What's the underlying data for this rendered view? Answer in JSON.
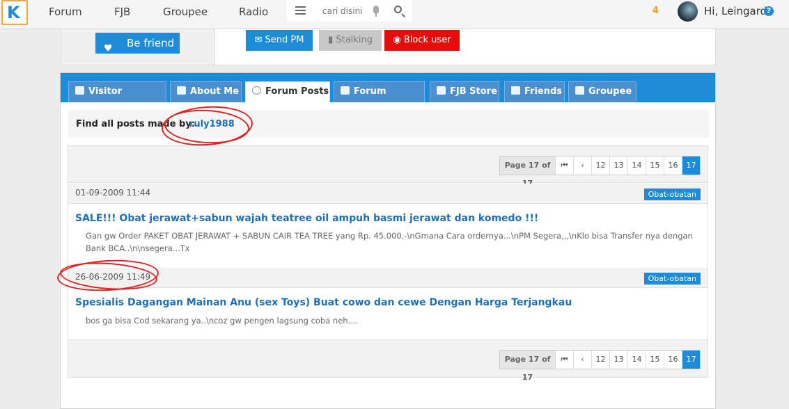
{
  "nav": {
    "logo": "K",
    "items": [
      "Forum",
      "FJB",
      "Groupee",
      "Radio"
    ],
    "search_placeholder": "cari disini",
    "notif_count": "4",
    "greeting": "Hi, Leingard",
    "help": "?"
  },
  "profile_actions": {
    "be_friend": "Be friend",
    "send_pm": "Send PM",
    "stalking": "Stalking",
    "block_user": "Block user"
  },
  "tabs": [
    "Visitor Message",
    "About Me",
    "Forum Posts",
    "Forum Thread",
    "FJB Store",
    "Friends",
    "Groupee"
  ],
  "active_tab": "Forum Posts",
  "find": {
    "label": "Find all posts made by:",
    "username": "ruly1988"
  },
  "pager": {
    "info": "Page 17 of 17",
    "first": "⏮",
    "prev": "‹",
    "pages": [
      "12",
      "13",
      "14",
      "15",
      "16"
    ],
    "current": "17"
  },
  "posts": [
    {
      "date": "01-09-2009 11:44",
      "category": "Obat-obatan",
      "title": "SALE!!! Obat jerawat+sabun wajah teatree oil ampuh basmi jerawat dan komedo !!!",
      "snippet": "Gan gw Order PAKET OBAT JERAWAT + SABUN CAIR TEA TREE yang Rp. 45.000,-\\nGmana Cara ordernya...\\nPM Segera,,,\\nKlo bisa Transfer nya dengan Bank BCA..\\n\\nsegera...Tx"
    },
    {
      "date": "26-06-2009 11:49",
      "category": "Obat-obatan",
      "title": "Spesialis Dagangan Mainan Anu (sex Toys) Buat cowo dan cewe Dengan Harga Terjangkau",
      "snippet": "bos ga bisa Cod sekarang ya..\\ncoz gw pengen lagsung coba neh...."
    }
  ],
  "colors": {
    "primary": "#1e8bd8",
    "block": "#e60c0c",
    "annotation": "#e3201f"
  }
}
